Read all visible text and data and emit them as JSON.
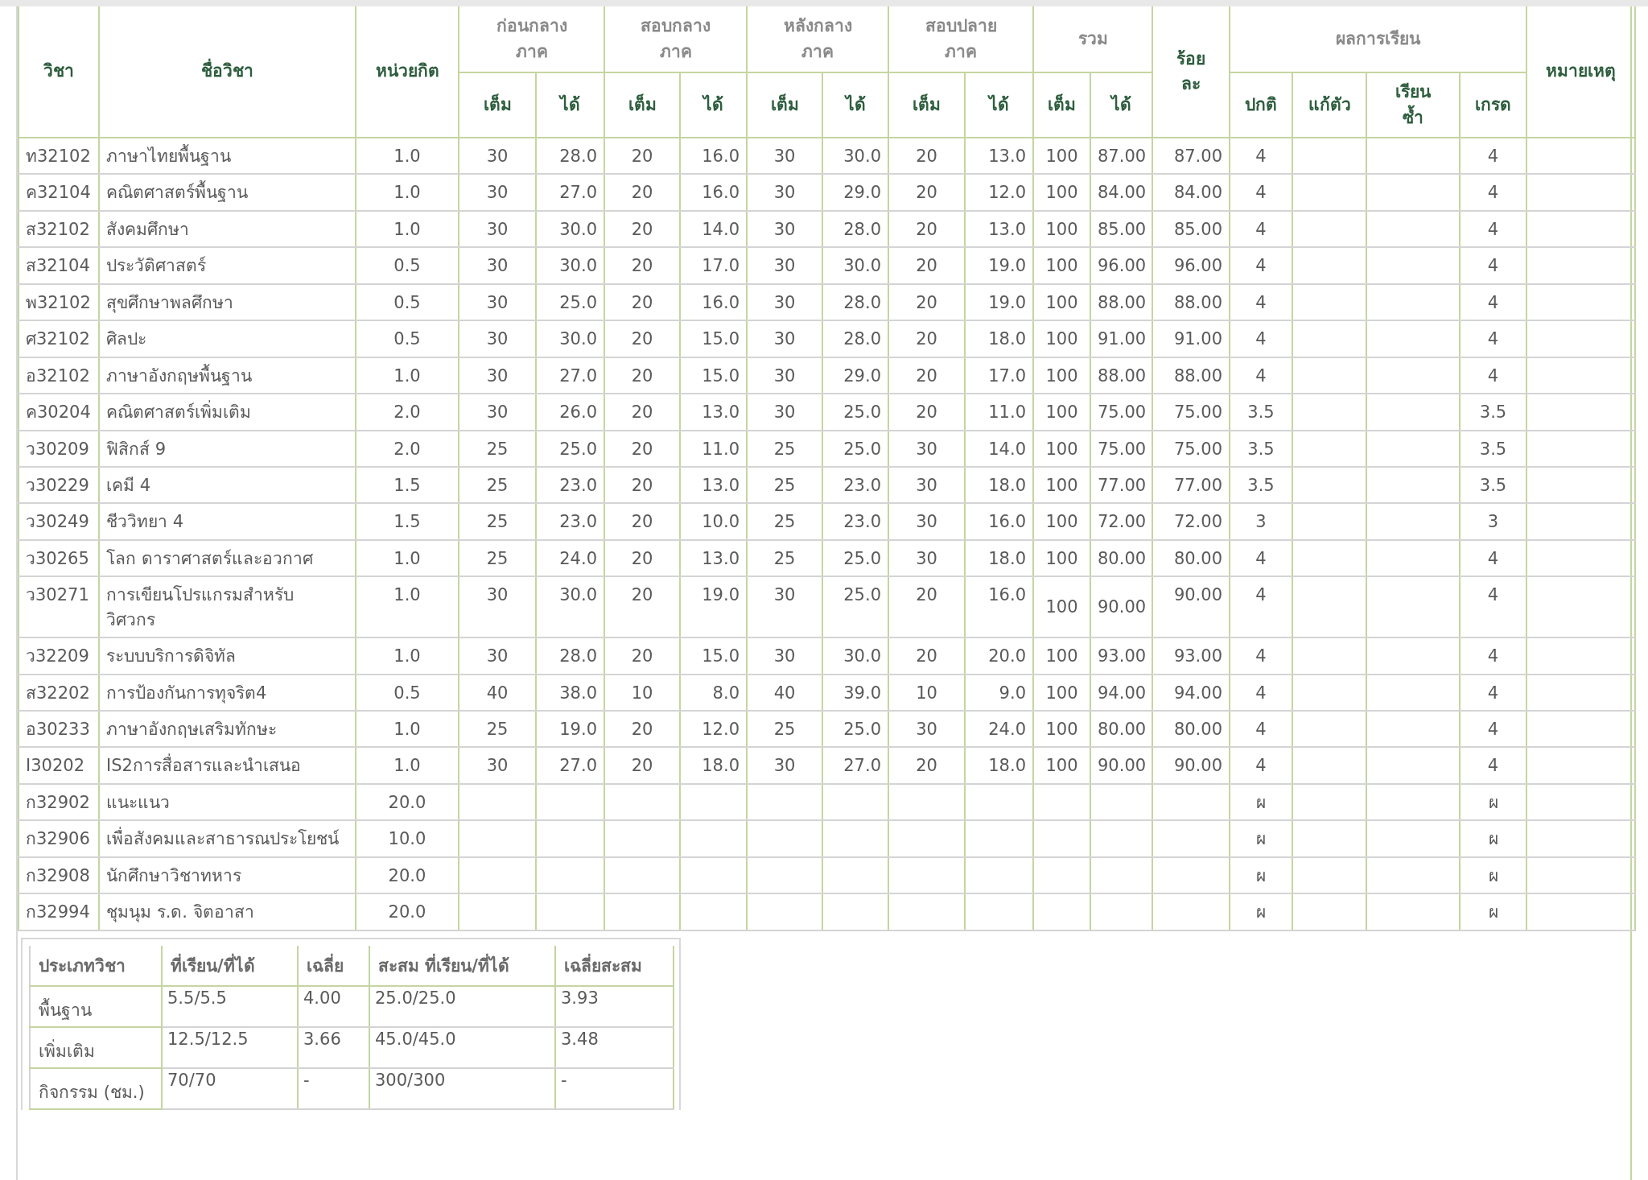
{
  "grades_table": {
    "header_groups": [
      {
        "kind": "single",
        "label": "วิชา"
      },
      {
        "kind": "single",
        "label": "ชื่อวิชา"
      },
      {
        "kind": "single",
        "label": "หน่วยกิต"
      },
      {
        "kind": "group",
        "label": "ก่อนกลาง\nภาค",
        "sub": [
          "เต็ม",
          "ได้"
        ]
      },
      {
        "kind": "group",
        "label": "สอบกลาง\nภาค",
        "sub": [
          "เต็ม",
          "ได้"
        ]
      },
      {
        "kind": "group",
        "label": "หลังกลาง\nภาค",
        "sub": [
          "เต็ม",
          "ได้"
        ]
      },
      {
        "kind": "group",
        "label": "สอบปลาย\nภาค",
        "sub": [
          "เต็ม",
          "ได้"
        ]
      },
      {
        "kind": "group",
        "label": "รวม",
        "sub": [
          "เต็ม",
          "ได้"
        ]
      },
      {
        "kind": "single",
        "label": "ร้อย\nละ"
      },
      {
        "kind": "group",
        "label": "ผลการเรียน",
        "sub": [
          "ปกติ",
          "แก้ตัว",
          "เรียน\nซ้ำ",
          "เกรด"
        ]
      },
      {
        "kind": "single",
        "label": "หมายเหตุ"
      }
    ],
    "rows": [
      {
        "code": "ท32102",
        "name": "ภาษาไทยพื้นฐาน",
        "credit": "1.0",
        "pre_full": "30",
        "pre_got": "28.0",
        "mid_full": "20",
        "mid_got": "16.0",
        "post_full": "30",
        "post_got": "30.0",
        "final_full": "20",
        "final_got": "13.0",
        "total_full": "100",
        "total_got": "87.00",
        "percent": "87.00",
        "normal": "4",
        "grade": "4"
      },
      {
        "code": "ค32104",
        "name": "คณิตศาสตร์พื้นฐาน",
        "credit": "1.0",
        "pre_full": "30",
        "pre_got": "27.0",
        "mid_full": "20",
        "mid_got": "16.0",
        "post_full": "30",
        "post_got": "29.0",
        "final_full": "20",
        "final_got": "12.0",
        "total_full": "100",
        "total_got": "84.00",
        "percent": "84.00",
        "normal": "4",
        "grade": "4"
      },
      {
        "code": "ส32102",
        "name": "สังคมศึกษา",
        "credit": "1.0",
        "pre_full": "30",
        "pre_got": "30.0",
        "mid_full": "20",
        "mid_got": "14.0",
        "post_full": "30",
        "post_got": "28.0",
        "final_full": "20",
        "final_got": "13.0",
        "total_full": "100",
        "total_got": "85.00",
        "percent": "85.00",
        "normal": "4",
        "grade": "4"
      },
      {
        "code": "ส32104",
        "name": "ประวัติศาสตร์",
        "credit": "0.5",
        "pre_full": "30",
        "pre_got": "30.0",
        "mid_full": "20",
        "mid_got": "17.0",
        "post_full": "30",
        "post_got": "30.0",
        "final_full": "20",
        "final_got": "19.0",
        "total_full": "100",
        "total_got": "96.00",
        "percent": "96.00",
        "normal": "4",
        "grade": "4"
      },
      {
        "code": "พ32102",
        "name": "สุขศึกษาพลศึกษา",
        "credit": "0.5",
        "pre_full": "30",
        "pre_got": "25.0",
        "mid_full": "20",
        "mid_got": "16.0",
        "post_full": "30",
        "post_got": "28.0",
        "final_full": "20",
        "final_got": "19.0",
        "total_full": "100",
        "total_got": "88.00",
        "percent": "88.00",
        "normal": "4",
        "grade": "4"
      },
      {
        "code": "ศ32102",
        "name": "ศิลปะ",
        "credit": "0.5",
        "pre_full": "30",
        "pre_got": "30.0",
        "mid_full": "20",
        "mid_got": "15.0",
        "post_full": "30",
        "post_got": "28.0",
        "final_full": "20",
        "final_got": "18.0",
        "total_full": "100",
        "total_got": "91.00",
        "percent": "91.00",
        "normal": "4",
        "grade": "4"
      },
      {
        "code": "อ32102",
        "name": "ภาษาอังกฤษพื้นฐาน",
        "credit": "1.0",
        "pre_full": "30",
        "pre_got": "27.0",
        "mid_full": "20",
        "mid_got": "15.0",
        "post_full": "30",
        "post_got": "29.0",
        "final_full": "20",
        "final_got": "17.0",
        "total_full": "100",
        "total_got": "88.00",
        "percent": "88.00",
        "normal": "4",
        "grade": "4"
      },
      {
        "code": "ค30204",
        "name": "คณิตศาสตร์เพิ่มเติม",
        "credit": "2.0",
        "pre_full": "30",
        "pre_got": "26.0",
        "mid_full": "20",
        "mid_got": "13.0",
        "post_full": "30",
        "post_got": "25.0",
        "final_full": "20",
        "final_got": "11.0",
        "total_full": "100",
        "total_got": "75.00",
        "percent": "75.00",
        "normal": "3.5",
        "grade": "3.5"
      },
      {
        "code": "ว30209",
        "name": "ฟิสิกส์ 9",
        "credit": "2.0",
        "pre_full": "25",
        "pre_got": "25.0",
        "mid_full": "20",
        "mid_got": "11.0",
        "post_full": "25",
        "post_got": "25.0",
        "final_full": "30",
        "final_got": "14.0",
        "total_full": "100",
        "total_got": "75.00",
        "percent": "75.00",
        "normal": "3.5",
        "grade": "3.5"
      },
      {
        "code": "ว30229",
        "name": "เคมี 4",
        "credit": "1.5",
        "pre_full": "25",
        "pre_got": "23.0",
        "mid_full": "20",
        "mid_got": "13.0",
        "post_full": "25",
        "post_got": "23.0",
        "final_full": "30",
        "final_got": "18.0",
        "total_full": "100",
        "total_got": "77.00",
        "percent": "77.00",
        "normal": "3.5",
        "grade": "3.5"
      },
      {
        "code": "ว30249",
        "name": "ชีววิทยา 4",
        "credit": "1.5",
        "pre_full": "25",
        "pre_got": "23.0",
        "mid_full": "20",
        "mid_got": "10.0",
        "post_full": "25",
        "post_got": "23.0",
        "final_full": "30",
        "final_got": "16.0",
        "total_full": "100",
        "total_got": "72.00",
        "percent": "72.00",
        "normal": "3",
        "grade": "3"
      },
      {
        "code": "ว30265",
        "name": "โลก ดาราศาสตร์และอวกาศ",
        "credit": "1.0",
        "pre_full": "25",
        "pre_got": "24.0",
        "mid_full": "20",
        "mid_got": "13.0",
        "post_full": "25",
        "post_got": "25.0",
        "final_full": "30",
        "final_got": "18.0",
        "total_full": "100",
        "total_got": "80.00",
        "percent": "80.00",
        "normal": "4",
        "grade": "4"
      },
      {
        "code": "ว30271",
        "name": "การเขียนโปรแกรมสำหรับ\nวิศวกร",
        "credit": "1.0",
        "pre_full": "30",
        "pre_got": "30.0",
        "mid_full": "20",
        "mid_got": "19.0",
        "post_full": "30",
        "post_got": "25.0",
        "final_full": "20",
        "final_got": "16.0",
        "total_full": "100",
        "total_got": "90.00",
        "percent": "90.00",
        "normal": "4",
        "grade": "4"
      },
      {
        "code": "ว32209",
        "name": "ระบบบริการดิจิทัล",
        "credit": "1.0",
        "pre_full": "30",
        "pre_got": "28.0",
        "mid_full": "20",
        "mid_got": "15.0",
        "post_full": "30",
        "post_got": "30.0",
        "final_full": "20",
        "final_got": "20.0",
        "total_full": "100",
        "total_got": "93.00",
        "percent": "93.00",
        "normal": "4",
        "grade": "4"
      },
      {
        "code": "ส32202",
        "name": "การป้องกันการทุจริต4",
        "credit": "0.5",
        "pre_full": "40",
        "pre_got": "38.0",
        "mid_full": "10",
        "mid_got": "8.0",
        "post_full": "40",
        "post_got": "39.0",
        "final_full": "10",
        "final_got": "9.0",
        "total_full": "100",
        "total_got": "94.00",
        "percent": "94.00",
        "normal": "4",
        "grade": "4"
      },
      {
        "code": "อ30233",
        "name": "ภาษาอังกฤษเสริมทักษะ",
        "credit": "1.0",
        "pre_full": "25",
        "pre_got": "19.0",
        "mid_full": "20",
        "mid_got": "12.0",
        "post_full": "25",
        "post_got": "25.0",
        "final_full": "30",
        "final_got": "24.0",
        "total_full": "100",
        "total_got": "80.00",
        "percent": "80.00",
        "normal": "4",
        "grade": "4"
      },
      {
        "code": "I30202",
        "name": "IS2การสื่อสารและนำเสนอ",
        "credit": "1.0",
        "pre_full": "30",
        "pre_got": "27.0",
        "mid_full": "20",
        "mid_got": "18.0",
        "post_full": "30",
        "post_got": "27.0",
        "final_full": "20",
        "final_got": "18.0",
        "total_full": "100",
        "total_got": "90.00",
        "percent": "90.00",
        "normal": "4",
        "grade": "4"
      },
      {
        "code": "ก32902",
        "name": "แนะแนว",
        "credit": "20.0",
        "normal": "ผ",
        "grade": "ผ"
      },
      {
        "code": "ก32906",
        "name": "เพื่อสังคมและสาธารณประโยชน์",
        "credit": "10.0",
        "normal": "ผ",
        "grade": "ผ"
      },
      {
        "code": "ก32908",
        "name": "นักศึกษาวิชาทหาร",
        "credit": "20.0",
        "normal": "ผ",
        "grade": "ผ"
      },
      {
        "code": "ก32994",
        "name": "ชุมนุม ร.ด. จิตอาสา",
        "credit": "20.0",
        "normal": "ผ",
        "grade": "ผ"
      }
    ]
  },
  "summary_table": {
    "columns": [
      "ประเภทวิชา",
      "ที่เรียน/ที่ได้",
      "เฉลี่ย",
      "สะสม ที่เรียน/ที่ได้",
      "เฉลี่ยสะสม"
    ],
    "rows": [
      [
        "พื้นฐาน",
        "5.5/5.5",
        "4.00",
        "25.0/25.0",
        "3.93"
      ],
      [
        "เพิ่มเติม",
        "12.5/12.5",
        "3.66",
        "45.0/45.0",
        "3.48"
      ],
      [
        "กิจกรรม (ชม.)",
        "70/70",
        "-",
        "300/300",
        "-"
      ]
    ]
  }
}
